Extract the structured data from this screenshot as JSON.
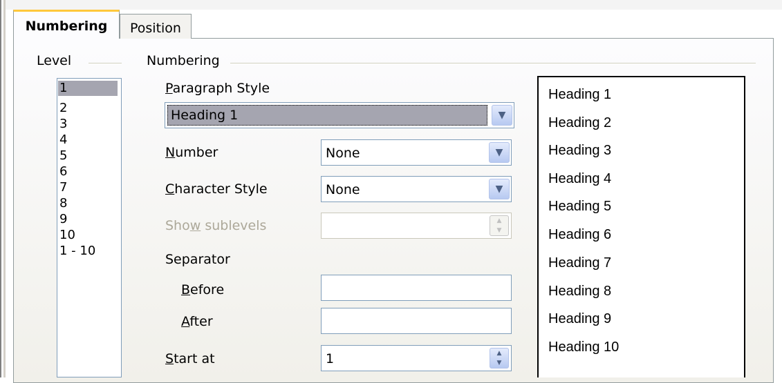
{
  "tabs": [
    {
      "label": "Numbering",
      "active": true
    },
    {
      "label": "Position",
      "active": false
    }
  ],
  "level": {
    "group_label": "Level",
    "items": [
      "1",
      "2",
      "3",
      "4",
      "5",
      "6",
      "7",
      "8",
      "9",
      "10",
      "1 - 10"
    ],
    "selected": "1"
  },
  "numbering": {
    "group_label": "Numbering",
    "paragraph_style": {
      "label": "Paragraph Style",
      "accesskey": "P",
      "value": "Heading 1"
    },
    "number": {
      "label": "Number",
      "accesskey": "N",
      "value": "None"
    },
    "character_style": {
      "label": "Character Style",
      "accesskey": "C",
      "value": "None"
    },
    "show_sublevels": {
      "label": "Show sublevels",
      "accesskey": "w",
      "value": "",
      "disabled": true
    },
    "separator": {
      "label": "Separator"
    },
    "before": {
      "label": "Before",
      "accesskey": "B",
      "value": ""
    },
    "after": {
      "label": "After",
      "accesskey": "A",
      "value": ""
    },
    "start_at": {
      "label": "Start at",
      "accesskey": "S",
      "value": "1"
    }
  },
  "preview": {
    "items": [
      "Heading 1",
      "Heading 2",
      "Heading 3",
      "Heading 4",
      "Heading 5",
      "Heading 6",
      "Heading 7",
      "Heading 8",
      "Heading 9",
      "Heading 10"
    ]
  },
  "colors": {
    "tab_highlight": "#ffc83c",
    "selection": "#a5a5b0",
    "input_border": "#7f9db9"
  },
  "icons": {
    "dropdown": "chevron-down-icon",
    "spinner": "spin-updown-icon"
  }
}
